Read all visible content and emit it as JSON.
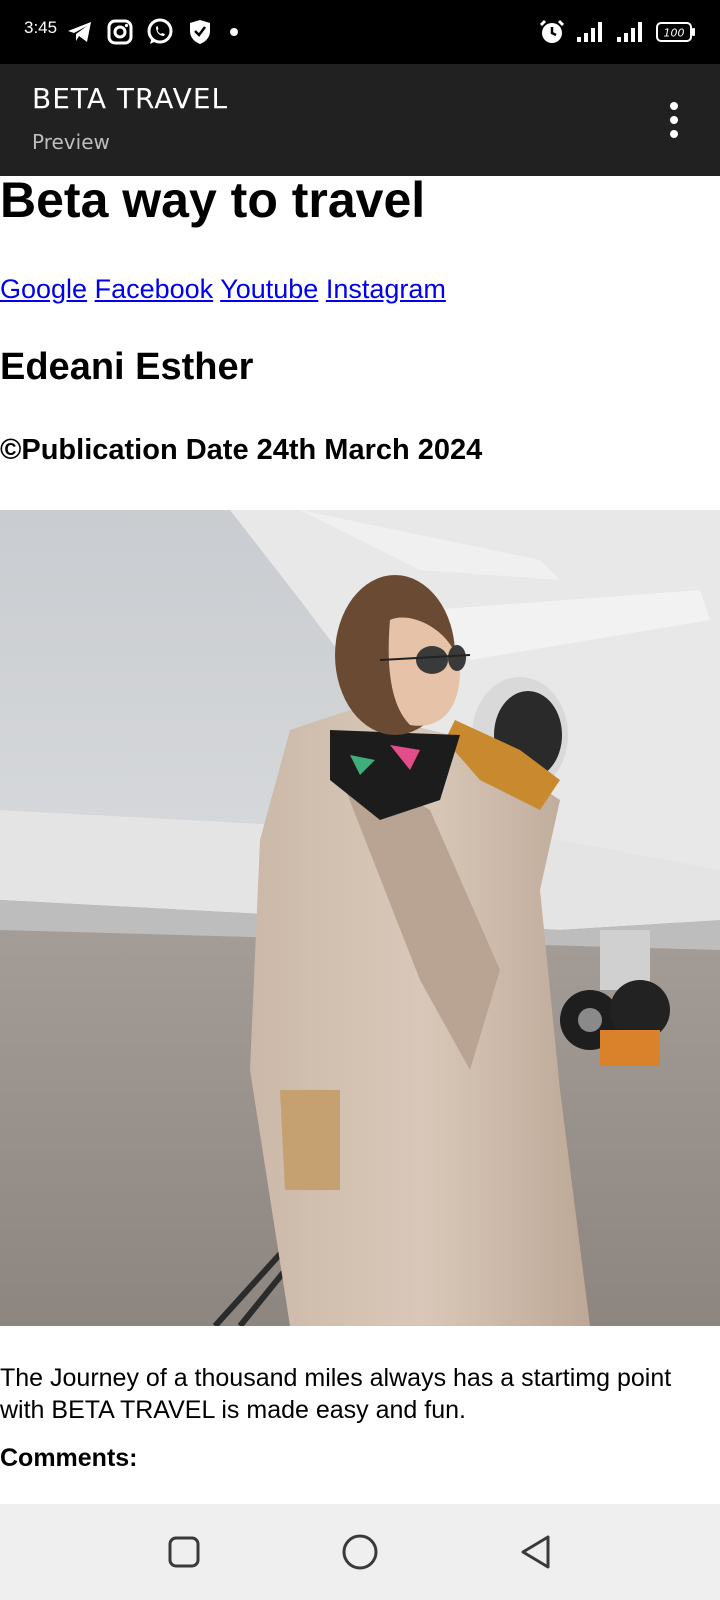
{
  "status_bar": {
    "time": "3:45",
    "battery": "100",
    "icons": [
      "telegram-icon",
      "instagram-icon",
      "whatsapp-icon",
      "shield-icon",
      "notification-dot",
      "alarm-icon",
      "signal-icon",
      "signal-icon-2",
      "battery-icon"
    ]
  },
  "app_bar": {
    "title": "BETA TRAVEL",
    "subtitle": "Preview",
    "menu_icon": "overflow-menu-icon"
  },
  "page": {
    "heading": "Beta way to travel",
    "links": [
      "Google",
      "Facebook",
      "Youtube",
      "Instagram"
    ],
    "author": "Edeani Esther",
    "publication": "©Publication Date 24th March 2024",
    "body": "The Journey of a thousand miles always has a startimg point with BETA TRAVEL is made easy and fun.",
    "comments_label": "Comments:"
  },
  "nav_bar": {
    "buttons": [
      "recents-button",
      "home-button",
      "back-button"
    ]
  },
  "colors": {
    "status_bar": "#000000",
    "app_bar": "#212121",
    "link": "#0000ee",
    "nav_bar": "#efefef"
  }
}
